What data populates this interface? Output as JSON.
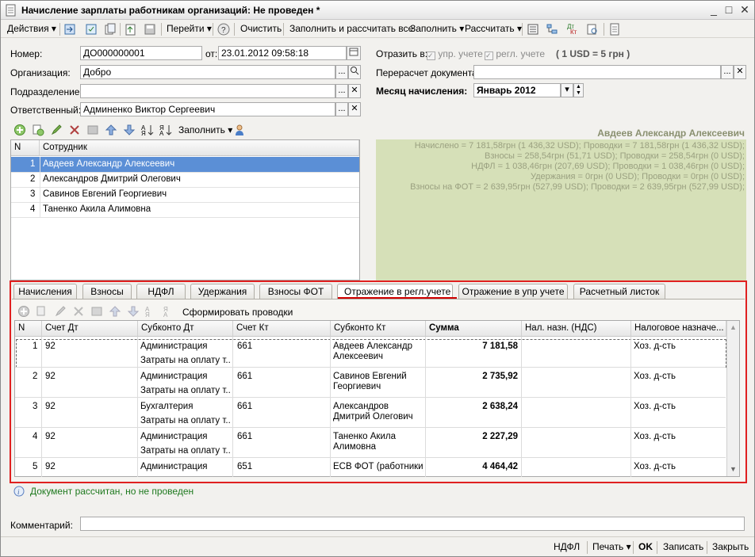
{
  "window": {
    "title": "Начисление зарплаты работникам организаций: Не проведен *",
    "controls": [
      "_",
      "□",
      "✕"
    ]
  },
  "toolbar": {
    "actions": "Действия",
    "go": "Перейти",
    "clear": "Очистить",
    "fill_calc_all": "Заполнить и рассчитать все",
    "fill": "Заполнить",
    "calc": "Рассчитать"
  },
  "header": {
    "number_label": "Номер:",
    "number": "ДО000000001",
    "from_label": "от:",
    "date": "23.01.2012 09:58:18",
    "org_label": "Организация:",
    "org": "Добро",
    "dept_label": "Подразделение:",
    "dept": "",
    "resp_label": "Ответственный:",
    "resp": "Админенко Виктор Сергеевич",
    "reflect_label": "Отразить в:",
    "reflect_upr": "упр. учете",
    "reflect_regl": "регл. учете",
    "rate": "( 1 USD = 5 грн )",
    "recalc_label": "Перерасчет документа:",
    "recalc": "",
    "month_label": "Месяц начисления:",
    "month": "Январь 2012"
  },
  "emp_toolbar": {
    "fill": "Заполнить"
  },
  "employees": {
    "col_n": "N",
    "col_name": "Сотрудник",
    "rows": [
      {
        "n": "1",
        "name": "Авдеев Александр Алексеевич"
      },
      {
        "n": "2",
        "name": "Александров Дмитрий Олегович"
      },
      {
        "n": "3",
        "name": "Савинов Евгений Георгиевич"
      },
      {
        "n": "4",
        "name": "Таненко Акила Алимовна"
      }
    ]
  },
  "summary": {
    "name": "Авдеев Александр Алексеевич",
    "lines": [
      "Начислено = 7 181,58грн (1 436,32 USD);   Проводки = 7 181,58грн (1 436,32 USD);",
      "Взносы = 258,54грн (51,71 USD);   Проводки = 258,54грн (0 USD);",
      "НДФЛ = 1 038,46грн (207,69 USD);   Проводки = 1 038,46грн (0 USD);",
      "Удержания = 0грн (0 USD);   Проводки = 0грн (0 USD);",
      "Взносы на ФОТ = 2 639,95грн (527,99 USD);   Проводки = 2 639,95грн (527,99 USD);"
    ]
  },
  "tabs": [
    "Начисления",
    "Взносы",
    "НДФЛ",
    "Удержания",
    "Взносы ФОТ",
    "Отражение в регл.учете",
    "Отражение в упр учете",
    "Расчетный листок"
  ],
  "postings": {
    "form_button": "Сформировать проводки",
    "cols": {
      "n": "N",
      "dt": "Счет Дт",
      "sub_dt": "Субконто Дт",
      "kt": "Счет Кт",
      "sub_kt": "Субконто Кт",
      "sum": "Сумма",
      "tax": "Нал. назн. (НДС)",
      "purpose": "Налоговое назначе..."
    },
    "rows": [
      {
        "n": "1",
        "dt": "92",
        "sub1": "Администрация",
        "sub2": "Затраты на оплату т...",
        "kt": "661",
        "skt1": "Авдеев Александр",
        "skt2": "Алексеевич",
        "sum": "7 181,58",
        "tax": "",
        "purpose": "Хоз. д-сть"
      },
      {
        "n": "2",
        "dt": "92",
        "sub1": "Администрация",
        "sub2": "Затраты на оплату т...",
        "kt": "661",
        "skt1": "Савинов Евгений",
        "skt2": "Георгиевич",
        "sum": "2 735,92",
        "tax": "",
        "purpose": "Хоз. д-сть"
      },
      {
        "n": "3",
        "dt": "92",
        "sub1": "Бухгалтерия",
        "sub2": "Затраты на оплату т...",
        "kt": "661",
        "skt1": "Александров",
        "skt2": "Дмитрий Олегович",
        "sum": "2 638,24",
        "tax": "",
        "purpose": "Хоз. д-сть"
      },
      {
        "n": "4",
        "dt": "92",
        "sub1": "Администрация",
        "sub2": "Затраты на оплату т...",
        "kt": "661",
        "skt1": "Таненко Акила",
        "skt2": "Алимовна",
        "sum": "2 227,29",
        "tax": "",
        "purpose": "Хоз. д-сть"
      },
      {
        "n": "5",
        "dt": "92",
        "sub1": "Администрация",
        "sub2": "",
        "kt": "651",
        "skt1": "ЕСВ ФОТ (работники)",
        "skt2": "",
        "sum": "4 464,42",
        "tax": "",
        "purpose": "Хоз. д-сть"
      }
    ]
  },
  "status": "Документ рассчитан, но не проведен",
  "comment_label": "Комментарий:",
  "comment": "",
  "footer": {
    "ndfl": "НДФЛ",
    "print": "Печать",
    "ok": "OK",
    "save": "Записать",
    "close": "Закрыть"
  }
}
